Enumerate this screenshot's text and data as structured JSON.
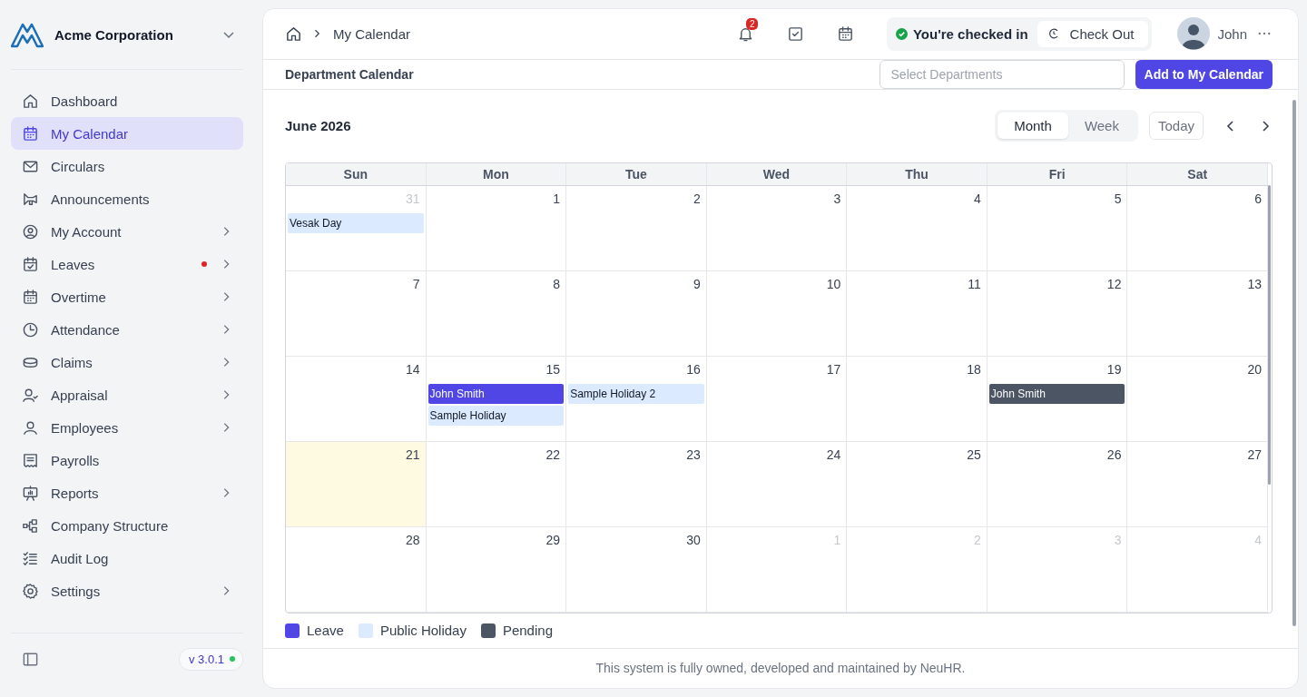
{
  "company": {
    "name": "Acme Corporation"
  },
  "sidebar": {
    "items": [
      {
        "label": "Dashboard",
        "selected": false,
        "expandable": false,
        "alert": false
      },
      {
        "label": "My Calendar",
        "selected": true,
        "expandable": false,
        "alert": false
      },
      {
        "label": "Circulars",
        "selected": false,
        "expandable": false,
        "alert": false
      },
      {
        "label": "Announcements",
        "selected": false,
        "expandable": false,
        "alert": false
      },
      {
        "label": "My Account",
        "selected": false,
        "expandable": true,
        "alert": false
      },
      {
        "label": "Leaves",
        "selected": false,
        "expandable": true,
        "alert": true
      },
      {
        "label": "Overtime",
        "selected": false,
        "expandable": true,
        "alert": false
      },
      {
        "label": "Attendance",
        "selected": false,
        "expandable": true,
        "alert": false
      },
      {
        "label": "Claims",
        "selected": false,
        "expandable": true,
        "alert": false
      },
      {
        "label": "Appraisal",
        "selected": false,
        "expandable": true,
        "alert": false
      },
      {
        "label": "Employees",
        "selected": false,
        "expandable": true,
        "alert": false
      },
      {
        "label": "Payrolls",
        "selected": false,
        "expandable": false,
        "alert": false
      },
      {
        "label": "Reports",
        "selected": false,
        "expandable": true,
        "alert": false
      },
      {
        "label": "Company Structure",
        "selected": false,
        "expandable": false,
        "alert": false
      },
      {
        "label": "Audit Log",
        "selected": false,
        "expandable": false,
        "alert": false
      },
      {
        "label": "Settings",
        "selected": false,
        "expandable": true,
        "alert": false
      }
    ],
    "version": "v 3.0.1"
  },
  "header": {
    "breadcrumb": "My Calendar",
    "notification_count": "2",
    "status": "You're checked in",
    "check_out": "Check Out",
    "user": "John"
  },
  "toolbar": {
    "title": "Department Calendar",
    "select_placeholder": "Select Departments",
    "add_button": "Add to My Calendar"
  },
  "calendar": {
    "title": "June 2026",
    "views": [
      {
        "label": "Month",
        "selected": true
      },
      {
        "label": "Week",
        "selected": false
      }
    ],
    "today_button": "Today",
    "weekdays": [
      "Sun",
      "Mon",
      "Tue",
      "Wed",
      "Thu",
      "Fri",
      "Sat"
    ],
    "weeks": [
      [
        {
          "day": "31",
          "other_month": true,
          "today": false,
          "events": [
            {
              "title": "Vesak Day",
              "kind": "holiday"
            }
          ]
        },
        {
          "day": "1",
          "other_month": false,
          "today": false
        },
        {
          "day": "2",
          "other_month": false,
          "today": false
        },
        {
          "day": "3",
          "other_month": false,
          "today": false
        },
        {
          "day": "4",
          "other_month": false,
          "today": false
        },
        {
          "day": "5",
          "other_month": false,
          "today": false
        },
        {
          "day": "6",
          "other_month": false,
          "today": false
        }
      ],
      [
        {
          "day": "7",
          "other_month": false,
          "today": false
        },
        {
          "day": "8",
          "other_month": false,
          "today": false
        },
        {
          "day": "9",
          "other_month": false,
          "today": false
        },
        {
          "day": "10",
          "other_month": false,
          "today": false
        },
        {
          "day": "11",
          "other_month": false,
          "today": false
        },
        {
          "day": "12",
          "other_month": false,
          "today": false
        },
        {
          "day": "13",
          "other_month": false,
          "today": false
        }
      ],
      [
        {
          "day": "14",
          "other_month": false,
          "today": false
        },
        {
          "day": "15",
          "other_month": false,
          "today": false,
          "events": [
            {
              "title": "John Smith",
              "kind": "leave"
            },
            {
              "title": "Sample Holiday",
              "kind": "holiday"
            }
          ]
        },
        {
          "day": "16",
          "other_month": false,
          "today": false,
          "events": [
            {
              "title": "Sample Holiday 2",
              "kind": "holiday"
            }
          ]
        },
        {
          "day": "17",
          "other_month": false,
          "today": false
        },
        {
          "day": "18",
          "other_month": false,
          "today": false
        },
        {
          "day": "19",
          "other_month": false,
          "today": false,
          "events": [
            {
              "title": "John Smith",
              "kind": "pending"
            }
          ]
        },
        {
          "day": "20",
          "other_month": false,
          "today": false
        }
      ],
      [
        {
          "day": "21",
          "other_month": false,
          "today": true
        },
        {
          "day": "22",
          "other_month": false,
          "today": false
        },
        {
          "day": "23",
          "other_month": false,
          "today": false
        },
        {
          "day": "24",
          "other_month": false,
          "today": false
        },
        {
          "day": "25",
          "other_month": false,
          "today": false
        },
        {
          "day": "26",
          "other_month": false,
          "today": false
        },
        {
          "day": "27",
          "other_month": false,
          "today": false
        }
      ],
      [
        {
          "day": "28",
          "other_month": false,
          "today": false
        },
        {
          "day": "29",
          "other_month": false,
          "today": false
        },
        {
          "day": "30",
          "other_month": false,
          "today": false
        },
        {
          "day": "1",
          "other_month": true,
          "today": false
        },
        {
          "day": "2",
          "other_month": true,
          "today": false
        },
        {
          "day": "3",
          "other_month": true,
          "today": false
        },
        {
          "day": "4",
          "other_month": true,
          "today": false
        }
      ]
    ],
    "legend": [
      {
        "label": "Leave",
        "kind": "leave",
        "color": "#4f46e5"
      },
      {
        "label": "Public Holiday",
        "kind": "holiday",
        "color": "#dbeafe"
      },
      {
        "label": "Pending",
        "kind": "pending",
        "color": "#4b5563"
      }
    ]
  },
  "footer": "This system is fully owned, developed and maintained by NeuHR."
}
